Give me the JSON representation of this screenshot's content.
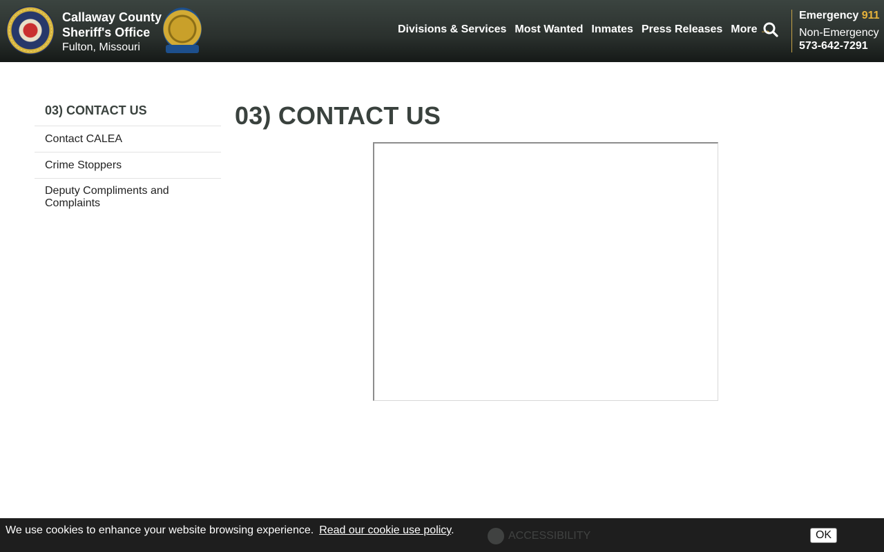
{
  "header": {
    "org_line1": "Callaway County",
    "org_line2": "Sheriff's Office",
    "location": "Fulton, Missouri",
    "nav": [
      {
        "label": "Divisions & Services"
      },
      {
        "label": "Most Wanted"
      },
      {
        "label": "Inmates"
      },
      {
        "label": "Press Releases"
      },
      {
        "label": "More"
      }
    ],
    "emergency_label": "Emergency",
    "emergency_number": "911",
    "non_emergency_label": "Non-Emergency",
    "non_emergency_number": "573-642-7291",
    "accent_color": "#e8b33a"
  },
  "sidebar": {
    "title": "03) CONTACT US",
    "items": [
      {
        "label": "Contact CALEA"
      },
      {
        "label": "Crime Stoppers"
      },
      {
        "label": "Deputy Compliments and Complaints"
      }
    ]
  },
  "main": {
    "title": "03) CONTACT US"
  },
  "footer": {
    "items": [
      {
        "label": "ACCESSIBILITY",
        "icon": "accessibility-icon"
      }
    ]
  },
  "cookie": {
    "message": "We use cookies to enhance your website browsing experience.",
    "policy_link": "Read our cookie use policy",
    "ok_label": "OK"
  }
}
